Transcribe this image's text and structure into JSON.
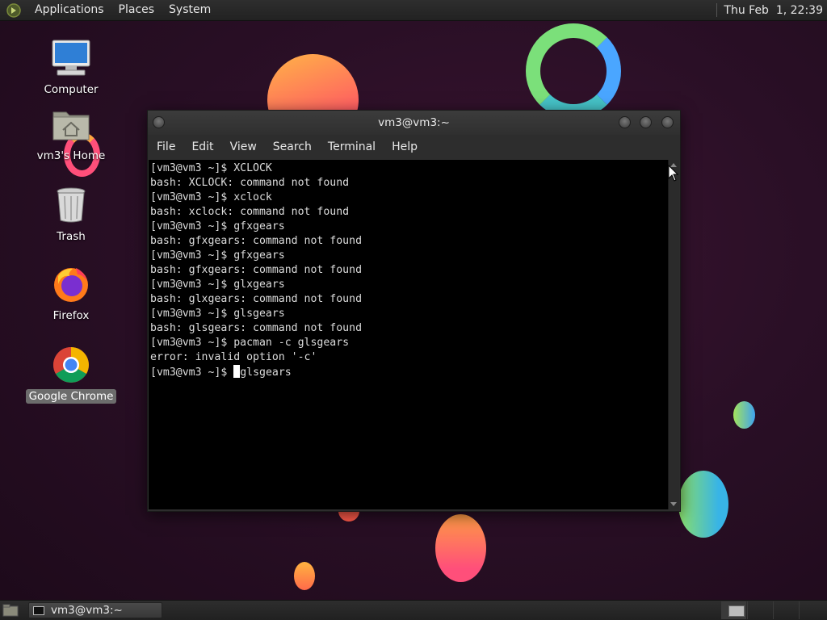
{
  "top_panel": {
    "menus": [
      "Applications",
      "Places",
      "System"
    ],
    "clock": "Thu Feb  1, 22:39"
  },
  "desktop": {
    "icons": [
      {
        "label": "Computer",
        "icon": "computer-icon"
      },
      {
        "label": "vm3's Home",
        "icon": "home-folder-icon"
      },
      {
        "label": "Trash",
        "icon": "trash-icon"
      },
      {
        "label": "Firefox",
        "icon": "firefox-icon"
      },
      {
        "label": "Google Chrome",
        "icon": "chrome-icon"
      }
    ]
  },
  "terminal": {
    "title": "vm3@vm3:~",
    "menu": [
      "File",
      "Edit",
      "View",
      "Search",
      "Terminal",
      "Help"
    ],
    "lines": [
      "[vm3@vm3 ~]$ XCLOCK",
      "bash: XCLOCK: command not found",
      "[vm3@vm3 ~]$ xclock",
      "bash: xclock: command not found",
      "[vm3@vm3 ~]$ gfxgears",
      "bash: gfxgears: command not found",
      "[vm3@vm3 ~]$ gfxgears",
      "bash: gfxgears: command not found",
      "[vm3@vm3 ~]$ glxgears",
      "bash: glxgears: command not found",
      "[vm3@vm3 ~]$ glsgears",
      "bash: glsgears: command not found",
      "[vm3@vm3 ~]$ pacman -c glsgears",
      "error: invalid option '-c'"
    ],
    "prompt": "[vm3@vm3 ~]$ ",
    "input_text": "glsgears"
  },
  "taskbar": {
    "window_label": "vm3@vm3:~"
  },
  "colors": {
    "background": "#2a0f26",
    "panel": "#262626",
    "terminal_bg": "#000000",
    "terminal_fg": "#dcdcdc"
  }
}
